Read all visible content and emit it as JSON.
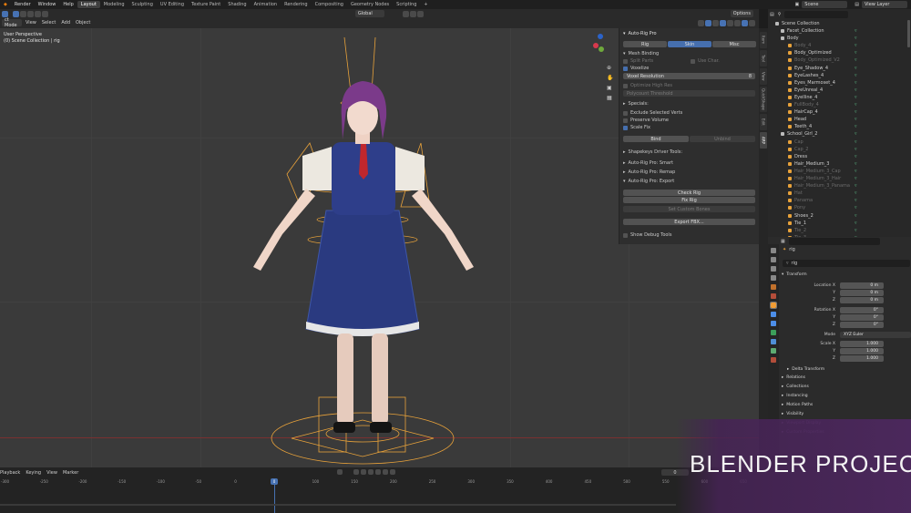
{
  "menu": {
    "items": [
      "Render",
      "Window",
      "Help"
    ]
  },
  "workspaces": [
    "Layout",
    "Modeling",
    "Sculpting",
    "UV Editing",
    "Texture Paint",
    "Shading",
    "Animation",
    "Rendering",
    "Compositing",
    "Geometry Nodes",
    "Scripting"
  ],
  "active_workspace": "Layout",
  "scene": {
    "name": "Scene",
    "view_layer": "View Layer"
  },
  "viewport": {
    "header": {
      "mode": "ct Mode",
      "menus": [
        "View",
        "Select",
        "Add",
        "Object"
      ],
      "orientation": "Global",
      "options": "Options"
    },
    "overlay_title": "User Perspective",
    "overlay_collection": "(0) Scene Collection | rig"
  },
  "autorig": {
    "title": "Auto-Rig Pro",
    "tabs": [
      "Rig",
      "Skin",
      "Misc"
    ],
    "active_tab": "Skin",
    "mesh_binding": "Mesh Binding",
    "split_parts": "Split Parts",
    "use_char": "Use Char.",
    "voxelize": "Voxelize",
    "voxel_resolution_label": "Voxel Resolution",
    "voxel_resolution_value": "8",
    "optimize_high_res": "Optimize High Res",
    "polycount_threshold": "Polycount Threshold",
    "specials": "Specials:",
    "exclude_selected_verts": "Exclude Selected Verts",
    "preserve_volume": "Preserve Volume",
    "scale_fix": "Scale Fix",
    "bind": "Bind",
    "unbind": "Unbind",
    "shapekeys_driver_tools": "Shapekeys Driver Tools:",
    "smart": "Auto-Rig Pro: Smart",
    "remap": "Auto-Rig Pro: Remap",
    "export": "Auto-Rig Pro: Export",
    "check_rig": "Check Rig",
    "fix_rig": "Fix Rig",
    "set_custom_bones": "Set Custom Bones",
    "export_fbx": "Export FBX...",
    "show_debug_tools": "Show Debug Tools"
  },
  "side_tabs": [
    "Item",
    "Tool",
    "View",
    "QuickShape",
    "Edit",
    "ARP"
  ],
  "outliner": {
    "root": "Scene Collection",
    "items": [
      {
        "name": "Facet_Collection",
        "dim": false
      },
      {
        "name": "Body",
        "dim": false
      },
      {
        "name": "Body_4",
        "dim": true
      },
      {
        "name": "Body_Optimized",
        "dim": false
      },
      {
        "name": "Body_Optimized_V2",
        "dim": true
      },
      {
        "name": "Eye_Shadow_4",
        "dim": false
      },
      {
        "name": "EyeLashes_4",
        "dim": false
      },
      {
        "name": "Eyes_Marmoset_4",
        "dim": false
      },
      {
        "name": "EyeUnreal_4",
        "dim": false
      },
      {
        "name": "Eyelline_4",
        "dim": false
      },
      {
        "name": "FullBody_4",
        "dim": true
      },
      {
        "name": "HairCap_4",
        "dim": false
      },
      {
        "name": "Head",
        "dim": false
      },
      {
        "name": "Teeth_4",
        "dim": false
      },
      {
        "name": "School_Girl_2",
        "dim": false
      },
      {
        "name": "Cap",
        "dim": true
      },
      {
        "name": "Cap_2",
        "dim": true
      },
      {
        "name": "Dress",
        "dim": false
      },
      {
        "name": "Hair_Medium_3",
        "dim": false
      },
      {
        "name": "Hair_Medium_3_Cap",
        "dim": true
      },
      {
        "name": "Hair_Medium_3_Hair",
        "dim": true
      },
      {
        "name": "Hair_Medium_3_Panama",
        "dim": true
      },
      {
        "name": "Hat",
        "dim": true
      },
      {
        "name": "Panama",
        "dim": true
      },
      {
        "name": "Pony",
        "dim": true
      },
      {
        "name": "Shoes_2",
        "dim": false
      },
      {
        "name": "Tie_1",
        "dim": false
      },
      {
        "name": "Tie_2",
        "dim": true
      },
      {
        "name": "Tie_3",
        "dim": true
      }
    ]
  },
  "properties": {
    "object": "rig",
    "data": "rig",
    "transform": "Transform",
    "location": {
      "label": "Location X",
      "x": "0 m",
      "y": "0 m",
      "z": "0 m"
    },
    "rotation": {
      "label": "Rotation X",
      "x": "0°",
      "y": "0°",
      "z": "0°"
    },
    "mode_label": "Mode",
    "mode": "XYZ Euler",
    "scale": {
      "label": "Scale X",
      "x": "1.000",
      "y": "1.000",
      "z": "1.000"
    },
    "axis_y": "Y",
    "axis_z": "Z",
    "delta_transform": "Delta Transform",
    "sections": [
      "Relations",
      "Collections",
      "Instancing",
      "Motion Paths",
      "Visibility",
      "Viewport Display",
      "Custom Properties"
    ]
  },
  "timeline": {
    "menus": [
      "Playback",
      "Keying",
      "View",
      "Marker"
    ],
    "current_frame": "0",
    "ticks": [
      "-300",
      "-250",
      "-200",
      "-150",
      "-100",
      "-50",
      "0",
      "50",
      "100",
      "150",
      "200",
      "250",
      "300",
      "350",
      "400",
      "450",
      "500",
      "550",
      "600",
      "650"
    ]
  },
  "overlay_text": "BLENDER PROJECT",
  "colors": {
    "accent": "#4772b3",
    "rig": "#e8a23a",
    "viewport": "#3a3a3a",
    "overlay": "#4e2860"
  }
}
